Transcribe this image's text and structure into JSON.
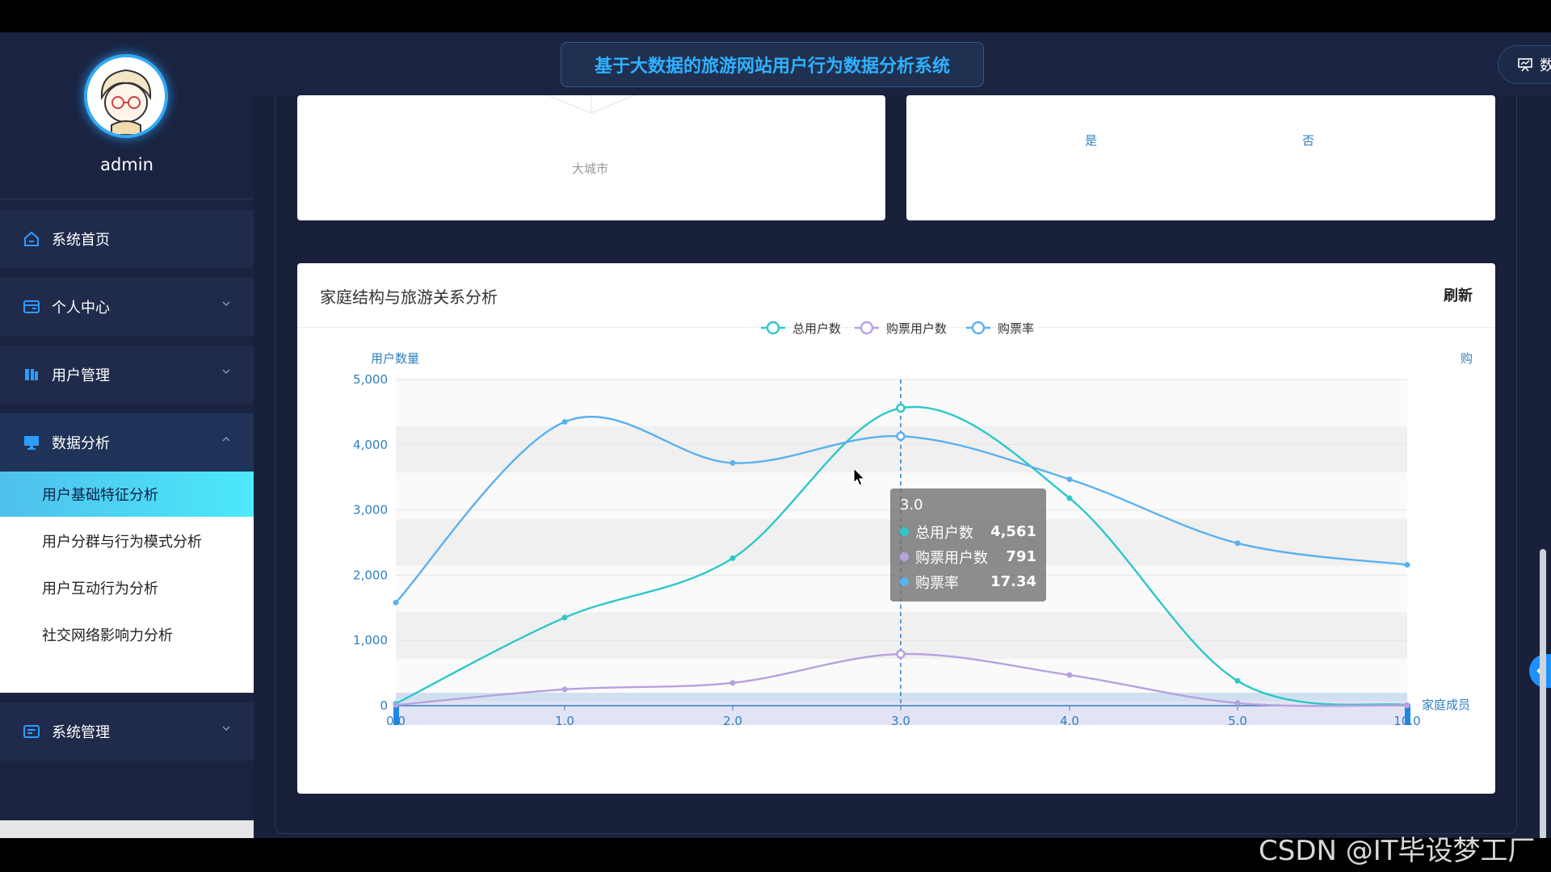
{
  "sidebar": {
    "username": "admin",
    "menu": [
      {
        "label": "系统首页",
        "icon": "home-icon"
      },
      {
        "label": "个人中心",
        "icon": "id-card-icon"
      },
      {
        "label": "用户管理",
        "icon": "user-manage-icon"
      },
      {
        "label": "数据分析",
        "icon": "monitor-icon"
      },
      {
        "label": "系统管理",
        "icon": "settings-card-icon"
      }
    ],
    "submenu": [
      {
        "label": "用户基础特征分析",
        "active": true
      },
      {
        "label": "用户分群与行为模式分析",
        "active": false
      },
      {
        "label": "用户互动行为分析",
        "active": false
      },
      {
        "label": "社交网络影响力分析",
        "active": false
      }
    ]
  },
  "header": {
    "title": "基于大数据的旅游网站用户行为数据分析系统",
    "dashboard_button": "数据看板",
    "user": "admin"
  },
  "top_cards": {
    "left_label": "大城市",
    "right_labels": [
      "是",
      "否"
    ]
  },
  "main_card": {
    "title": "家庭结构与旅游关系分析",
    "refresh": "刷新"
  },
  "chart_data": {
    "type": "line",
    "title": "",
    "legend": [
      "总用户数",
      "购票用户数",
      "购票率"
    ],
    "legend_position": "top-center",
    "ylabel_left": "用户数量",
    "ylabel_right": "购",
    "xlabel": "家庭成员",
    "x": [
      "0.0",
      "1.0",
      "2.0",
      "3.0",
      "4.0",
      "5.0",
      "10.0"
    ],
    "ylim": [
      0,
      5000
    ],
    "yticks": [
      "0",
      "1,000",
      "2,000",
      "3,000",
      "4,000",
      "5,000"
    ],
    "series": [
      {
        "name": "总用户数",
        "color": "#2ec7c9",
        "values": [
          30,
          1350,
          2260,
          4561,
          3180,
          380,
          10
        ]
      },
      {
        "name": "购票用户数",
        "color": "#b6a2de",
        "values": [
          10,
          250,
          350,
          791,
          470,
          40,
          5
        ]
      },
      {
        "name": "购票率",
        "color": "#5ab1ef",
        "axis": "right",
        "values": [
          1580,
          4350,
          3720,
          4130,
          3470,
          2490,
          2160
        ]
      }
    ],
    "grid": true,
    "tooltip": {
      "title": "3.0",
      "rows": [
        {
          "name": "总用户数",
          "value": "4,561",
          "color": "#2ec7c9"
        },
        {
          "name": "购票用户数",
          "value": "791",
          "color": "#b6a2de"
        },
        {
          "name": "购票率",
          "value": "17.34",
          "color": "#5ab1ef"
        }
      ]
    }
  },
  "watermark": "CSDN @IT毕设梦工厂"
}
